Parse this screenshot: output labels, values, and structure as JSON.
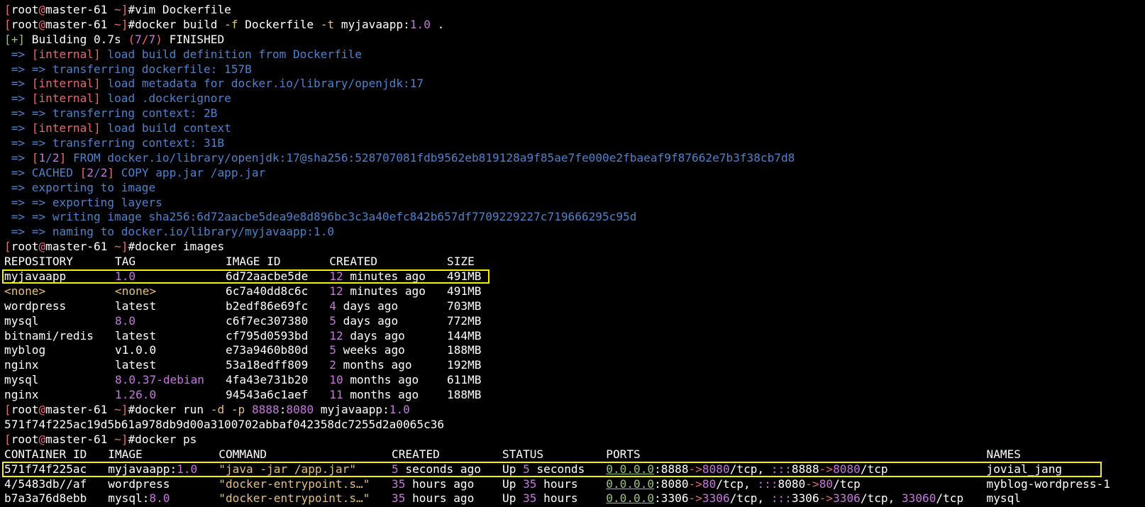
{
  "prompt": {
    "user": "root",
    "host": "master-61",
    "dir": " ~"
  },
  "commands": [
    "vim Dockerfile",
    "docker build -f Dockerfile -t myjavaapp:1.0 .",
    "docker images",
    "docker run -d -p 8888:8080 myjavaapp:1.0",
    "docker ps"
  ],
  "build": {
    "header": "Building 0.7s (7/7) FINISHED",
    "steps": [
      "=> [internal] load build definition from Dockerfile",
      "=> => transferring dockerfile: 157B",
      "=> [internal] load metadata for docker.io/library/openjdk:17",
      "=> [internal] load .dockerignore",
      "=> => transferring context: 2B",
      "=> [internal] load build context",
      "=> => transferring context: 31B",
      "=> [1/2] FROM docker.io/library/openjdk:17@sha256:528707081fdb9562eb819128a9f85ae7fe000e2fbaeaf9f87662e7b3f38cb7d8",
      "=> CACHED [2/2] COPY app.jar /app.jar",
      "=> exporting to image",
      "=> => exporting layers",
      "=> => writing image sha256:6d72aacbe5dea9e8d896bc3c3a40efc842b657df7709229227c719666295c95d",
      "=> => naming to docker.io/library/myjavaapp:1.0"
    ]
  },
  "images": {
    "headers": [
      "REPOSITORY",
      "TAG",
      "IMAGE ID",
      "CREATED",
      "SIZE"
    ],
    "rows": [
      [
        "myjavaapp",
        "1.0",
        "6d72aacbe5de",
        "12 minutes ago",
        "491MB"
      ],
      [
        "<none>",
        "<none>",
        "6c7a40dd8c6c",
        "12 minutes ago",
        "491MB"
      ],
      [
        "wordpress",
        "latest",
        "b2edf86e69fc",
        "4 days ago",
        "703MB"
      ],
      [
        "mysql",
        "8.0",
        "c6f7ec307380",
        "5 days ago",
        "772MB"
      ],
      [
        "bitnami/redis",
        "latest",
        "cf795d0593bd",
        "12 days ago",
        "144MB"
      ],
      [
        "myblog",
        "v1.0.0",
        "e73a9460b80d",
        "5 weeks ago",
        "188MB"
      ],
      [
        "nginx",
        "latest",
        "53a18edff809",
        "2 months ago",
        "192MB"
      ],
      [
        "mysql",
        "8.0.37-debian",
        "4fa43e731b20",
        "10 months ago",
        "611MB"
      ],
      [
        "nginx",
        "1.26.0",
        "94543a6c1aef",
        "11 months ago",
        "188MB"
      ]
    ]
  },
  "run_output": "571f74f225ac19d5b61a978db9d00a3100702abbaf042358dc7255d2a0065c36",
  "ps": {
    "headers": [
      "CONTAINER ID",
      "IMAGE",
      "COMMAND",
      "CREATED",
      "STATUS",
      "PORTS",
      "NAMES"
    ],
    "rows": [
      [
        "571f74f225ac",
        "myjavaapp:1.0",
        "\"java -jar /app.jar\"",
        "5 seconds ago",
        "Up 5 seconds",
        "0.0.0.0:8888->8080/tcp, :::8888->8080/tcp",
        "jovial_jang"
      ],
      [
        "4/5483db//af",
        "wordpress",
        "\"docker-entrypoint.s…\"",
        "35 hours ago",
        "Up 35 hours",
        "0.0.0.0:8080->80/tcp, :::8080->80/tcp",
        "myblog-wordpress-1"
      ],
      [
        "b7a3a76d8ebb",
        "mysql:8.0",
        "\"docker-entrypoint.s…\"",
        "35 hours ago",
        "Up 35 hours",
        "0.0.0.0:3306->3306/tcp, :::3306->3306/tcp, 33060/tcp",
        "mysql"
      ]
    ]
  },
  "colors": {
    "bracket": "#e06c75",
    "accent_number": "#c678dd",
    "flag": "#e5c07b",
    "build_text": "#4f82c9",
    "highlight_box": "#f2f200"
  }
}
